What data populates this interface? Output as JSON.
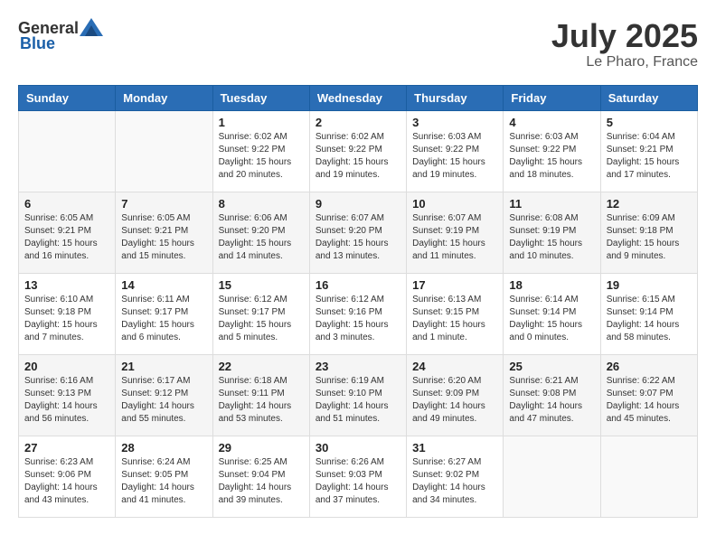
{
  "header": {
    "logo_general": "General",
    "logo_blue": "Blue",
    "month": "July 2025",
    "location": "Le Pharo, France"
  },
  "weekdays": [
    "Sunday",
    "Monday",
    "Tuesday",
    "Wednesday",
    "Thursday",
    "Friday",
    "Saturday"
  ],
  "weeks": [
    [
      {
        "day": "",
        "sunrise": "",
        "sunset": "",
        "daylight": "",
        "empty": true
      },
      {
        "day": "",
        "sunrise": "",
        "sunset": "",
        "daylight": "",
        "empty": true
      },
      {
        "day": "1",
        "sunrise": "Sunrise: 6:02 AM",
        "sunset": "Sunset: 9:22 PM",
        "daylight": "Daylight: 15 hours and 20 minutes."
      },
      {
        "day": "2",
        "sunrise": "Sunrise: 6:02 AM",
        "sunset": "Sunset: 9:22 PM",
        "daylight": "Daylight: 15 hours and 19 minutes."
      },
      {
        "day": "3",
        "sunrise": "Sunrise: 6:03 AM",
        "sunset": "Sunset: 9:22 PM",
        "daylight": "Daylight: 15 hours and 19 minutes."
      },
      {
        "day": "4",
        "sunrise": "Sunrise: 6:03 AM",
        "sunset": "Sunset: 9:22 PM",
        "daylight": "Daylight: 15 hours and 18 minutes."
      },
      {
        "day": "5",
        "sunrise": "Sunrise: 6:04 AM",
        "sunset": "Sunset: 9:21 PM",
        "daylight": "Daylight: 15 hours and 17 minutes."
      }
    ],
    [
      {
        "day": "6",
        "sunrise": "Sunrise: 6:05 AM",
        "sunset": "Sunset: 9:21 PM",
        "daylight": "Daylight: 15 hours and 16 minutes."
      },
      {
        "day": "7",
        "sunrise": "Sunrise: 6:05 AM",
        "sunset": "Sunset: 9:21 PM",
        "daylight": "Daylight: 15 hours and 15 minutes."
      },
      {
        "day": "8",
        "sunrise": "Sunrise: 6:06 AM",
        "sunset": "Sunset: 9:20 PM",
        "daylight": "Daylight: 15 hours and 14 minutes."
      },
      {
        "day": "9",
        "sunrise": "Sunrise: 6:07 AM",
        "sunset": "Sunset: 9:20 PM",
        "daylight": "Daylight: 15 hours and 13 minutes."
      },
      {
        "day": "10",
        "sunrise": "Sunrise: 6:07 AM",
        "sunset": "Sunset: 9:19 PM",
        "daylight": "Daylight: 15 hours and 11 minutes."
      },
      {
        "day": "11",
        "sunrise": "Sunrise: 6:08 AM",
        "sunset": "Sunset: 9:19 PM",
        "daylight": "Daylight: 15 hours and 10 minutes."
      },
      {
        "day": "12",
        "sunrise": "Sunrise: 6:09 AM",
        "sunset": "Sunset: 9:18 PM",
        "daylight": "Daylight: 15 hours and 9 minutes."
      }
    ],
    [
      {
        "day": "13",
        "sunrise": "Sunrise: 6:10 AM",
        "sunset": "Sunset: 9:18 PM",
        "daylight": "Daylight: 15 hours and 7 minutes."
      },
      {
        "day": "14",
        "sunrise": "Sunrise: 6:11 AM",
        "sunset": "Sunset: 9:17 PM",
        "daylight": "Daylight: 15 hours and 6 minutes."
      },
      {
        "day": "15",
        "sunrise": "Sunrise: 6:12 AM",
        "sunset": "Sunset: 9:17 PM",
        "daylight": "Daylight: 15 hours and 5 minutes."
      },
      {
        "day": "16",
        "sunrise": "Sunrise: 6:12 AM",
        "sunset": "Sunset: 9:16 PM",
        "daylight": "Daylight: 15 hours and 3 minutes."
      },
      {
        "day": "17",
        "sunrise": "Sunrise: 6:13 AM",
        "sunset": "Sunset: 9:15 PM",
        "daylight": "Daylight: 15 hours and 1 minute."
      },
      {
        "day": "18",
        "sunrise": "Sunrise: 6:14 AM",
        "sunset": "Sunset: 9:14 PM",
        "daylight": "Daylight: 15 hours and 0 minutes."
      },
      {
        "day": "19",
        "sunrise": "Sunrise: 6:15 AM",
        "sunset": "Sunset: 9:14 PM",
        "daylight": "Daylight: 14 hours and 58 minutes."
      }
    ],
    [
      {
        "day": "20",
        "sunrise": "Sunrise: 6:16 AM",
        "sunset": "Sunset: 9:13 PM",
        "daylight": "Daylight: 14 hours and 56 minutes."
      },
      {
        "day": "21",
        "sunrise": "Sunrise: 6:17 AM",
        "sunset": "Sunset: 9:12 PM",
        "daylight": "Daylight: 14 hours and 55 minutes."
      },
      {
        "day": "22",
        "sunrise": "Sunrise: 6:18 AM",
        "sunset": "Sunset: 9:11 PM",
        "daylight": "Daylight: 14 hours and 53 minutes."
      },
      {
        "day": "23",
        "sunrise": "Sunrise: 6:19 AM",
        "sunset": "Sunset: 9:10 PM",
        "daylight": "Daylight: 14 hours and 51 minutes."
      },
      {
        "day": "24",
        "sunrise": "Sunrise: 6:20 AM",
        "sunset": "Sunset: 9:09 PM",
        "daylight": "Daylight: 14 hours and 49 minutes."
      },
      {
        "day": "25",
        "sunrise": "Sunrise: 6:21 AM",
        "sunset": "Sunset: 9:08 PM",
        "daylight": "Daylight: 14 hours and 47 minutes."
      },
      {
        "day": "26",
        "sunrise": "Sunrise: 6:22 AM",
        "sunset": "Sunset: 9:07 PM",
        "daylight": "Daylight: 14 hours and 45 minutes."
      }
    ],
    [
      {
        "day": "27",
        "sunrise": "Sunrise: 6:23 AM",
        "sunset": "Sunset: 9:06 PM",
        "daylight": "Daylight: 14 hours and 43 minutes."
      },
      {
        "day": "28",
        "sunrise": "Sunrise: 6:24 AM",
        "sunset": "Sunset: 9:05 PM",
        "daylight": "Daylight: 14 hours and 41 minutes."
      },
      {
        "day": "29",
        "sunrise": "Sunrise: 6:25 AM",
        "sunset": "Sunset: 9:04 PM",
        "daylight": "Daylight: 14 hours and 39 minutes."
      },
      {
        "day": "30",
        "sunrise": "Sunrise: 6:26 AM",
        "sunset": "Sunset: 9:03 PM",
        "daylight": "Daylight: 14 hours and 37 minutes."
      },
      {
        "day": "31",
        "sunrise": "Sunrise: 6:27 AM",
        "sunset": "Sunset: 9:02 PM",
        "daylight": "Daylight: 14 hours and 34 minutes."
      },
      {
        "day": "",
        "sunrise": "",
        "sunset": "",
        "daylight": "",
        "empty": true
      },
      {
        "day": "",
        "sunrise": "",
        "sunset": "",
        "daylight": "",
        "empty": true
      }
    ]
  ]
}
